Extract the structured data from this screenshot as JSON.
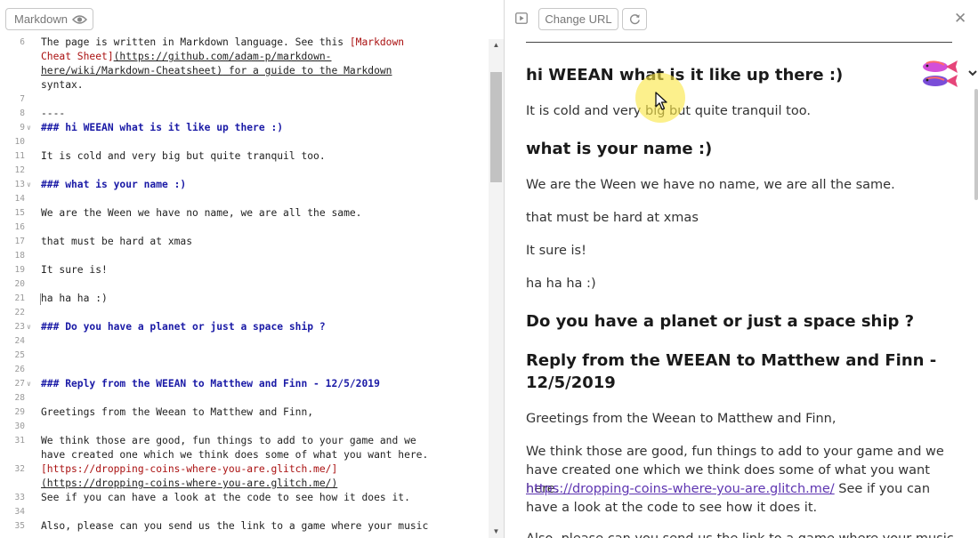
{
  "editor": {
    "mode_label": "Markdown",
    "lines": [
      {
        "n": "6",
        "t": "The page is written in Markdown language. See this ",
        "cls": "tx",
        "t2": "[Markdown",
        "cls2": "link"
      },
      {
        "n": "",
        "t": "Cheat Sheet]",
        "cls": "tx link",
        "t2": "(https://github.com/adam-p/markdown-",
        "cls2": "url"
      },
      {
        "n": "",
        "t": "here/wiki/Markdown-Cheatsheet)",
        "cls": "tx url",
        "t2": " for a guide to the Markdown",
        "cls2": "plain"
      },
      {
        "n": "",
        "t": "syntax.",
        "cls": "tx"
      },
      {
        "n": "7",
        "t": "",
        "cls": "tx"
      },
      {
        "n": "8",
        "t": "----",
        "cls": "tx"
      },
      {
        "n": "9",
        "t": "### hi WEEAN what is it like up there :)",
        "cls": "tx h",
        "fold": true
      },
      {
        "n": "10",
        "t": "",
        "cls": "tx"
      },
      {
        "n": "11",
        "t": "It is cold and very big but quite tranquil too.",
        "cls": "tx"
      },
      {
        "n": "12",
        "t": "",
        "cls": "tx"
      },
      {
        "n": "13",
        "t": "### what is your name :)",
        "cls": "tx h",
        "fold": true
      },
      {
        "n": "14",
        "t": "",
        "cls": "tx"
      },
      {
        "n": "15",
        "t": "We are the Ween we have no name, we are all the same.",
        "cls": "tx"
      },
      {
        "n": "16",
        "t": "",
        "cls": "tx"
      },
      {
        "n": "17",
        "t": "that must be hard at xmas",
        "cls": "tx"
      },
      {
        "n": "18",
        "t": "",
        "cls": "tx"
      },
      {
        "n": "19",
        "t": "It sure is!",
        "cls": "tx"
      },
      {
        "n": "20",
        "t": "",
        "cls": "tx"
      },
      {
        "n": "21",
        "t": "ha ha ha :)",
        "cls": "tx",
        "caret": true
      },
      {
        "n": "22",
        "t": "",
        "cls": "tx"
      },
      {
        "n": "23",
        "t": "### Do you have a planet or just a space ship ?",
        "cls": "tx h",
        "fold": true
      },
      {
        "n": "24",
        "t": "",
        "cls": "tx"
      },
      {
        "n": "25",
        "t": "",
        "cls": "tx"
      },
      {
        "n": "26",
        "t": "",
        "cls": "tx"
      },
      {
        "n": "27",
        "t": "### Reply from the WEEAN to Matthew and Finn - 12/5/2019",
        "cls": "tx h",
        "fold": true
      },
      {
        "n": "28",
        "t": "",
        "cls": "tx"
      },
      {
        "n": "29",
        "t": "Greetings from the Weean to Matthew and Finn,",
        "cls": "tx"
      },
      {
        "n": "30",
        "t": "",
        "cls": "tx"
      },
      {
        "n": "31",
        "t": "We think those are good, fun things to add to your game and we",
        "cls": "tx"
      },
      {
        "n": "",
        "t": "have created one which we think does some of what you want here.",
        "cls": "tx"
      },
      {
        "n": "32",
        "t": "[https://dropping-coins-where-you-are.glitch.me/]",
        "cls": "tx link"
      },
      {
        "n": "",
        "t": "(https://dropping-coins-where-you-are.glitch.me/)",
        "cls": "tx url"
      },
      {
        "n": "33",
        "t": "See if you can have a look at the code to see how it does it.",
        "cls": "tx"
      },
      {
        "n": "34",
        "t": "",
        "cls": "tx"
      },
      {
        "n": "35",
        "t": "Also, please can you send us the link to a game where your music",
        "cls": "tx"
      }
    ]
  },
  "toolbar": {
    "change_url_label": "Change URL",
    "play_icon": "preview-toggle-icon",
    "refresh_icon": "refresh-icon",
    "close_icon": "close-icon",
    "close_glyph": "✕"
  },
  "preview": {
    "h1": "hi WEEAN what is it like up there :)",
    "p1": "It is cold and very big but quite tranquil too.",
    "h2": "what is your name :)",
    "p2": "We are the Ween we have no name, we are all the same.",
    "p3": "that must be hard at xmas",
    "p4": "It sure is!",
    "p5": "ha ha ha :)",
    "h3": "Do you have a planet or just a space ship ?",
    "h4_line1": "Reply from the WEEAN to Matthew and Finn -",
    "h4_line2": "12/5/2019",
    "p6": "Greetings from the Weean to Matthew and Finn,",
    "p7_line1": "We think those are good, fun things to add to your game and we",
    "p7_line2": "have created one which we think does some of what you want here.",
    "p7_link": "https://dropping-coins-where-you-are.glitch.me/",
    "p7_after_link": " See if you can",
    "p7_line4": "have a look at the code to see how it does it.",
    "p8": "Also, please can you send us the link to a game where your music"
  },
  "colors": {
    "heading_code": "#1a1aa6",
    "link_code": "#aa1111",
    "link_preview": "#5e35b1",
    "cursor_highlight": "#fae646"
  }
}
